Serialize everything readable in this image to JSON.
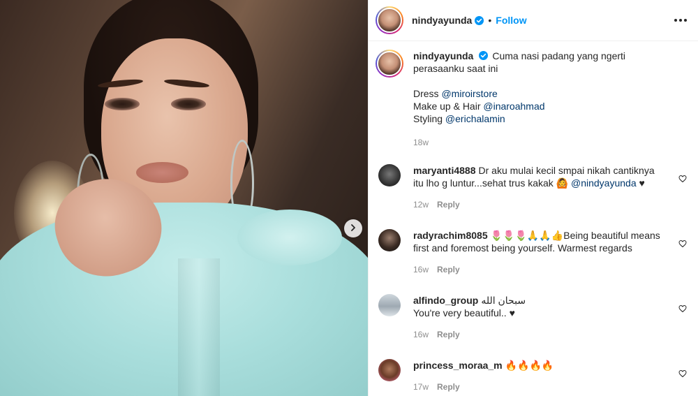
{
  "post": {
    "author": "nindyayunda",
    "follow_label": "Follow",
    "dot": "•"
  },
  "caption": {
    "username": "nindyayunda",
    "text_line1": "Cuma nasi padang yang ngerti perasaanku saat ini",
    "credits": [
      {
        "label": "Dress ",
        "mention": "@miroirstore"
      },
      {
        "label": "Make up & Hair ",
        "mention": "@inaroahmad"
      },
      {
        "label": "Styling ",
        "mention": "@erichalamin"
      }
    ],
    "time": "18w"
  },
  "comments": [
    {
      "username": "maryanti4888",
      "text": "Dr aku mulai kecil smpai nikah cantiknya itu lho g luntur...sehat trus kakak 🙆 ",
      "mention": "@nindyayunda",
      "suffix": " ♥",
      "time": "12w",
      "reply": "Reply"
    },
    {
      "username": "radyrachim8085",
      "text": "🌷🌷🌷🙏🙏👍Being beautiful means first and foremost being yourself. Warmest regards",
      "time": "16w",
      "reply": "Reply"
    },
    {
      "username": "alfindo_group",
      "text_line1": "سبحان الله",
      "text_line2": "You're very beautiful.. ♥",
      "time": "16w",
      "reply": "Reply"
    },
    {
      "username": "princess_moraa_m",
      "text": "🔥🔥🔥🔥",
      "time": "17w",
      "reply": "Reply"
    }
  ]
}
